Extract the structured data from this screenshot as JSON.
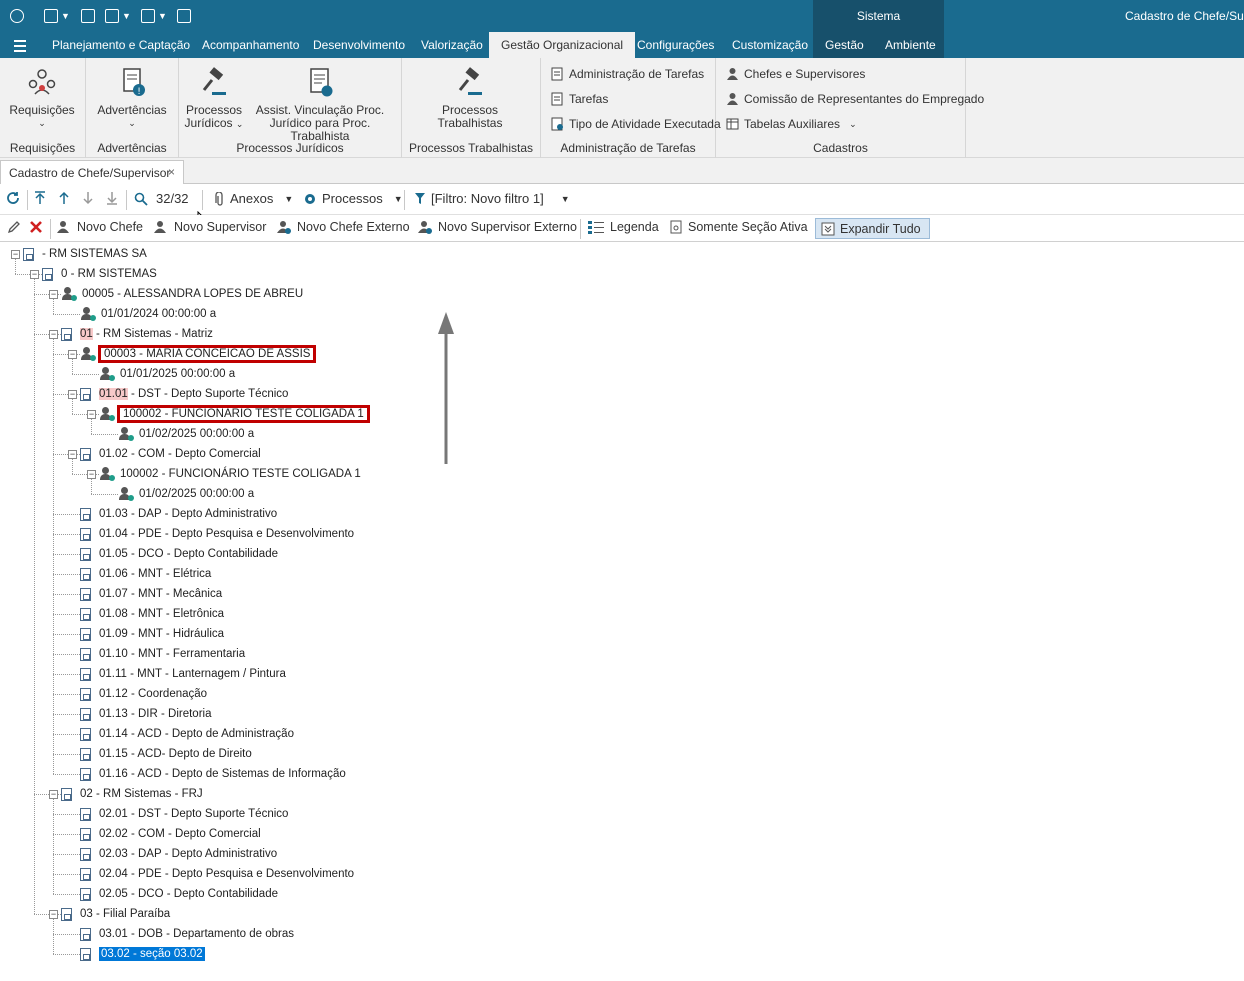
{
  "titlebar": {
    "system_tab": "Sistema",
    "window_title": "Cadastro de Chefe/Supe"
  },
  "menu": {
    "items": [
      "Planejamento e Captação",
      "Acompanhamento",
      "Desenvolvimento",
      "Valorização",
      "Gestão Organizacional",
      "Configurações",
      "Customização",
      "Gestão",
      "Ambiente"
    ],
    "active": "Gestão Organizacional"
  },
  "ribbon": {
    "requisicoes": {
      "button": "Requisições",
      "group": "Requisições"
    },
    "advertencias": {
      "button": "Advertências",
      "group": "Advertências"
    },
    "juridicos": {
      "btn1_line1": "Processos",
      "btn1_line2": "Jurídicos",
      "btn2_line1": "Assist. Vinculação Proc.",
      "btn2_line2": "Jurídico para Proc. Trabalhista",
      "group": "Processos Jurídicos"
    },
    "trabalhistas": {
      "btn_line1": "Processos",
      "btn_line2": "Trabalhistas",
      "group": "Processos Trabalhistas"
    },
    "tarefas": {
      "items": [
        "Administração de Tarefas",
        "Tarefas",
        "Tipo de Atividade Executada"
      ],
      "group": "Administração de Tarefas"
    },
    "cadastros": {
      "items": [
        "Chefes e Supervisores",
        "Comissão de Representantes do Empregado",
        "Tabelas Auxiliares"
      ],
      "group": "Cadastros"
    }
  },
  "doc_tab": {
    "label": "Cadastro de Chefe/Supervisor",
    "close": "×"
  },
  "toolbar1": {
    "record_count": "32/32",
    "anexos": "Anexos",
    "processos": "Processos",
    "filtro": "[Filtro: Novo filtro 1]"
  },
  "toolbar2": {
    "novo_chefe": "Novo Chefe",
    "novo_supervisor": "Novo Supervisor",
    "novo_chefe_externo": "Novo Chefe Externo",
    "novo_supervisor_externo": "Novo Supervisor Externo",
    "legenda": "Legenda",
    "somente_secao": "Somente Seção Ativa",
    "expandir": "Expandir Tudo"
  },
  "tree": [
    {
      "text": "- RM SISTEMAS SA",
      "level": 0,
      "icon": "doc",
      "expander": true
    },
    {
      "text": "0 - RM SISTEMAS",
      "level": 1,
      "icon": "doc",
      "expander": true
    },
    {
      "text": "00005 - ALESSANDRA LOPES DE ABREU",
      "level": 2,
      "icon": "person",
      "expander": true
    },
    {
      "text": "01/01/2024 00:00:00 a",
      "level": 3,
      "icon": "person"
    },
    {
      "text": "01 - RM Sistemas - Matriz",
      "level": 2,
      "icon": "doc",
      "expander": true,
      "pink": "01"
    },
    {
      "text": "00003 - MARIA CONCEICAO DE ASSIS",
      "level": 3,
      "icon": "person",
      "expander": true,
      "highlight": true
    },
    {
      "text": "01/01/2025 00:00:00 a",
      "level": 4,
      "icon": "person"
    },
    {
      "text": "01.01 - DST - Depto Suporte Técnico",
      "level": 3,
      "icon": "doc",
      "expander": true,
      "pink": "01.01"
    },
    {
      "text": "100002 - FUNCIONARIO TESTE COLIGADA 1",
      "level": 4,
      "icon": "person",
      "expander": true,
      "highlight": true
    },
    {
      "text": "01/02/2025 00:00:00 a",
      "level": 5,
      "icon": "person"
    },
    {
      "text": "01.02 - COM - Depto Comercial",
      "level": 3,
      "icon": "doc",
      "expander": true
    },
    {
      "text": "100002 - FUNCIONÁRIO TESTE COLIGADA 1",
      "level": 4,
      "icon": "person",
      "expander": true
    },
    {
      "text": "01/02/2025 00:00:00 a",
      "level": 5,
      "icon": "person"
    },
    {
      "text": "01.03 - DAP - Depto Administrativo",
      "level": 3,
      "icon": "doc"
    },
    {
      "text": "01.04 - PDE - Depto Pesquisa e Desenvolvimento",
      "level": 3,
      "icon": "doc"
    },
    {
      "text": "01.05 - DCO - Depto Contabilidade",
      "level": 3,
      "icon": "doc"
    },
    {
      "text": "01.06 - MNT - Elétrica",
      "level": 3,
      "icon": "doc"
    },
    {
      "text": "01.07 - MNT - Mecânica",
      "level": 3,
      "icon": "doc"
    },
    {
      "text": "01.08 - MNT - Eletrônica",
      "level": 3,
      "icon": "doc"
    },
    {
      "text": "01.09 - MNT - Hidráulica",
      "level": 3,
      "icon": "doc"
    },
    {
      "text": "01.10 - MNT - Ferramentaria",
      "level": 3,
      "icon": "doc"
    },
    {
      "text": "01.11 - MNT - Lanternagem / Pintura",
      "level": 3,
      "icon": "doc"
    },
    {
      "text": "01.12 - Coordenação",
      "level": 3,
      "icon": "doc"
    },
    {
      "text": "01.13 - DIR - Diretoria",
      "level": 3,
      "icon": "doc"
    },
    {
      "text": "01.14 - ACD - Depto de Administração",
      "level": 3,
      "icon": "doc"
    },
    {
      "text": "01.15 - ACD- Depto de Direito",
      "level": 3,
      "icon": "doc"
    },
    {
      "text": "01.16 - ACD - Depto de Sistemas de Informação",
      "level": 3,
      "icon": "doc"
    },
    {
      "text": "02 - RM Sistemas - FRJ",
      "level": 2,
      "icon": "doc",
      "expander": true
    },
    {
      "text": "02.01 - DST - Depto Suporte Técnico",
      "level": 3,
      "icon": "doc"
    },
    {
      "text": "02.02 - COM - Depto Comercial",
      "level": 3,
      "icon": "doc"
    },
    {
      "text": "02.03 - DAP - Depto Administrativo",
      "level": 3,
      "icon": "doc"
    },
    {
      "text": "02.04 - PDE - Depto Pesquisa e Desenvolvimento",
      "level": 3,
      "icon": "doc"
    },
    {
      "text": "02.05 - DCO - Depto Contabilidade",
      "level": 3,
      "icon": "doc"
    },
    {
      "text": "03 - Filial Paraíba",
      "level": 2,
      "icon": "doc",
      "expander": true
    },
    {
      "text": "03.01 - DOB - Departamento de obras",
      "level": 3,
      "icon": "doc"
    },
    {
      "text": "03.02 - seção 03.02",
      "level": 3,
      "icon": "doc",
      "selected": true
    }
  ],
  "colors": {
    "header": "#1a6b8f",
    "system_tab": "#17506b",
    "ribbon": "#f1f1f1",
    "highlight_box": "#c00000",
    "selection": "#0078d7",
    "pink": "#f7c9c9"
  }
}
